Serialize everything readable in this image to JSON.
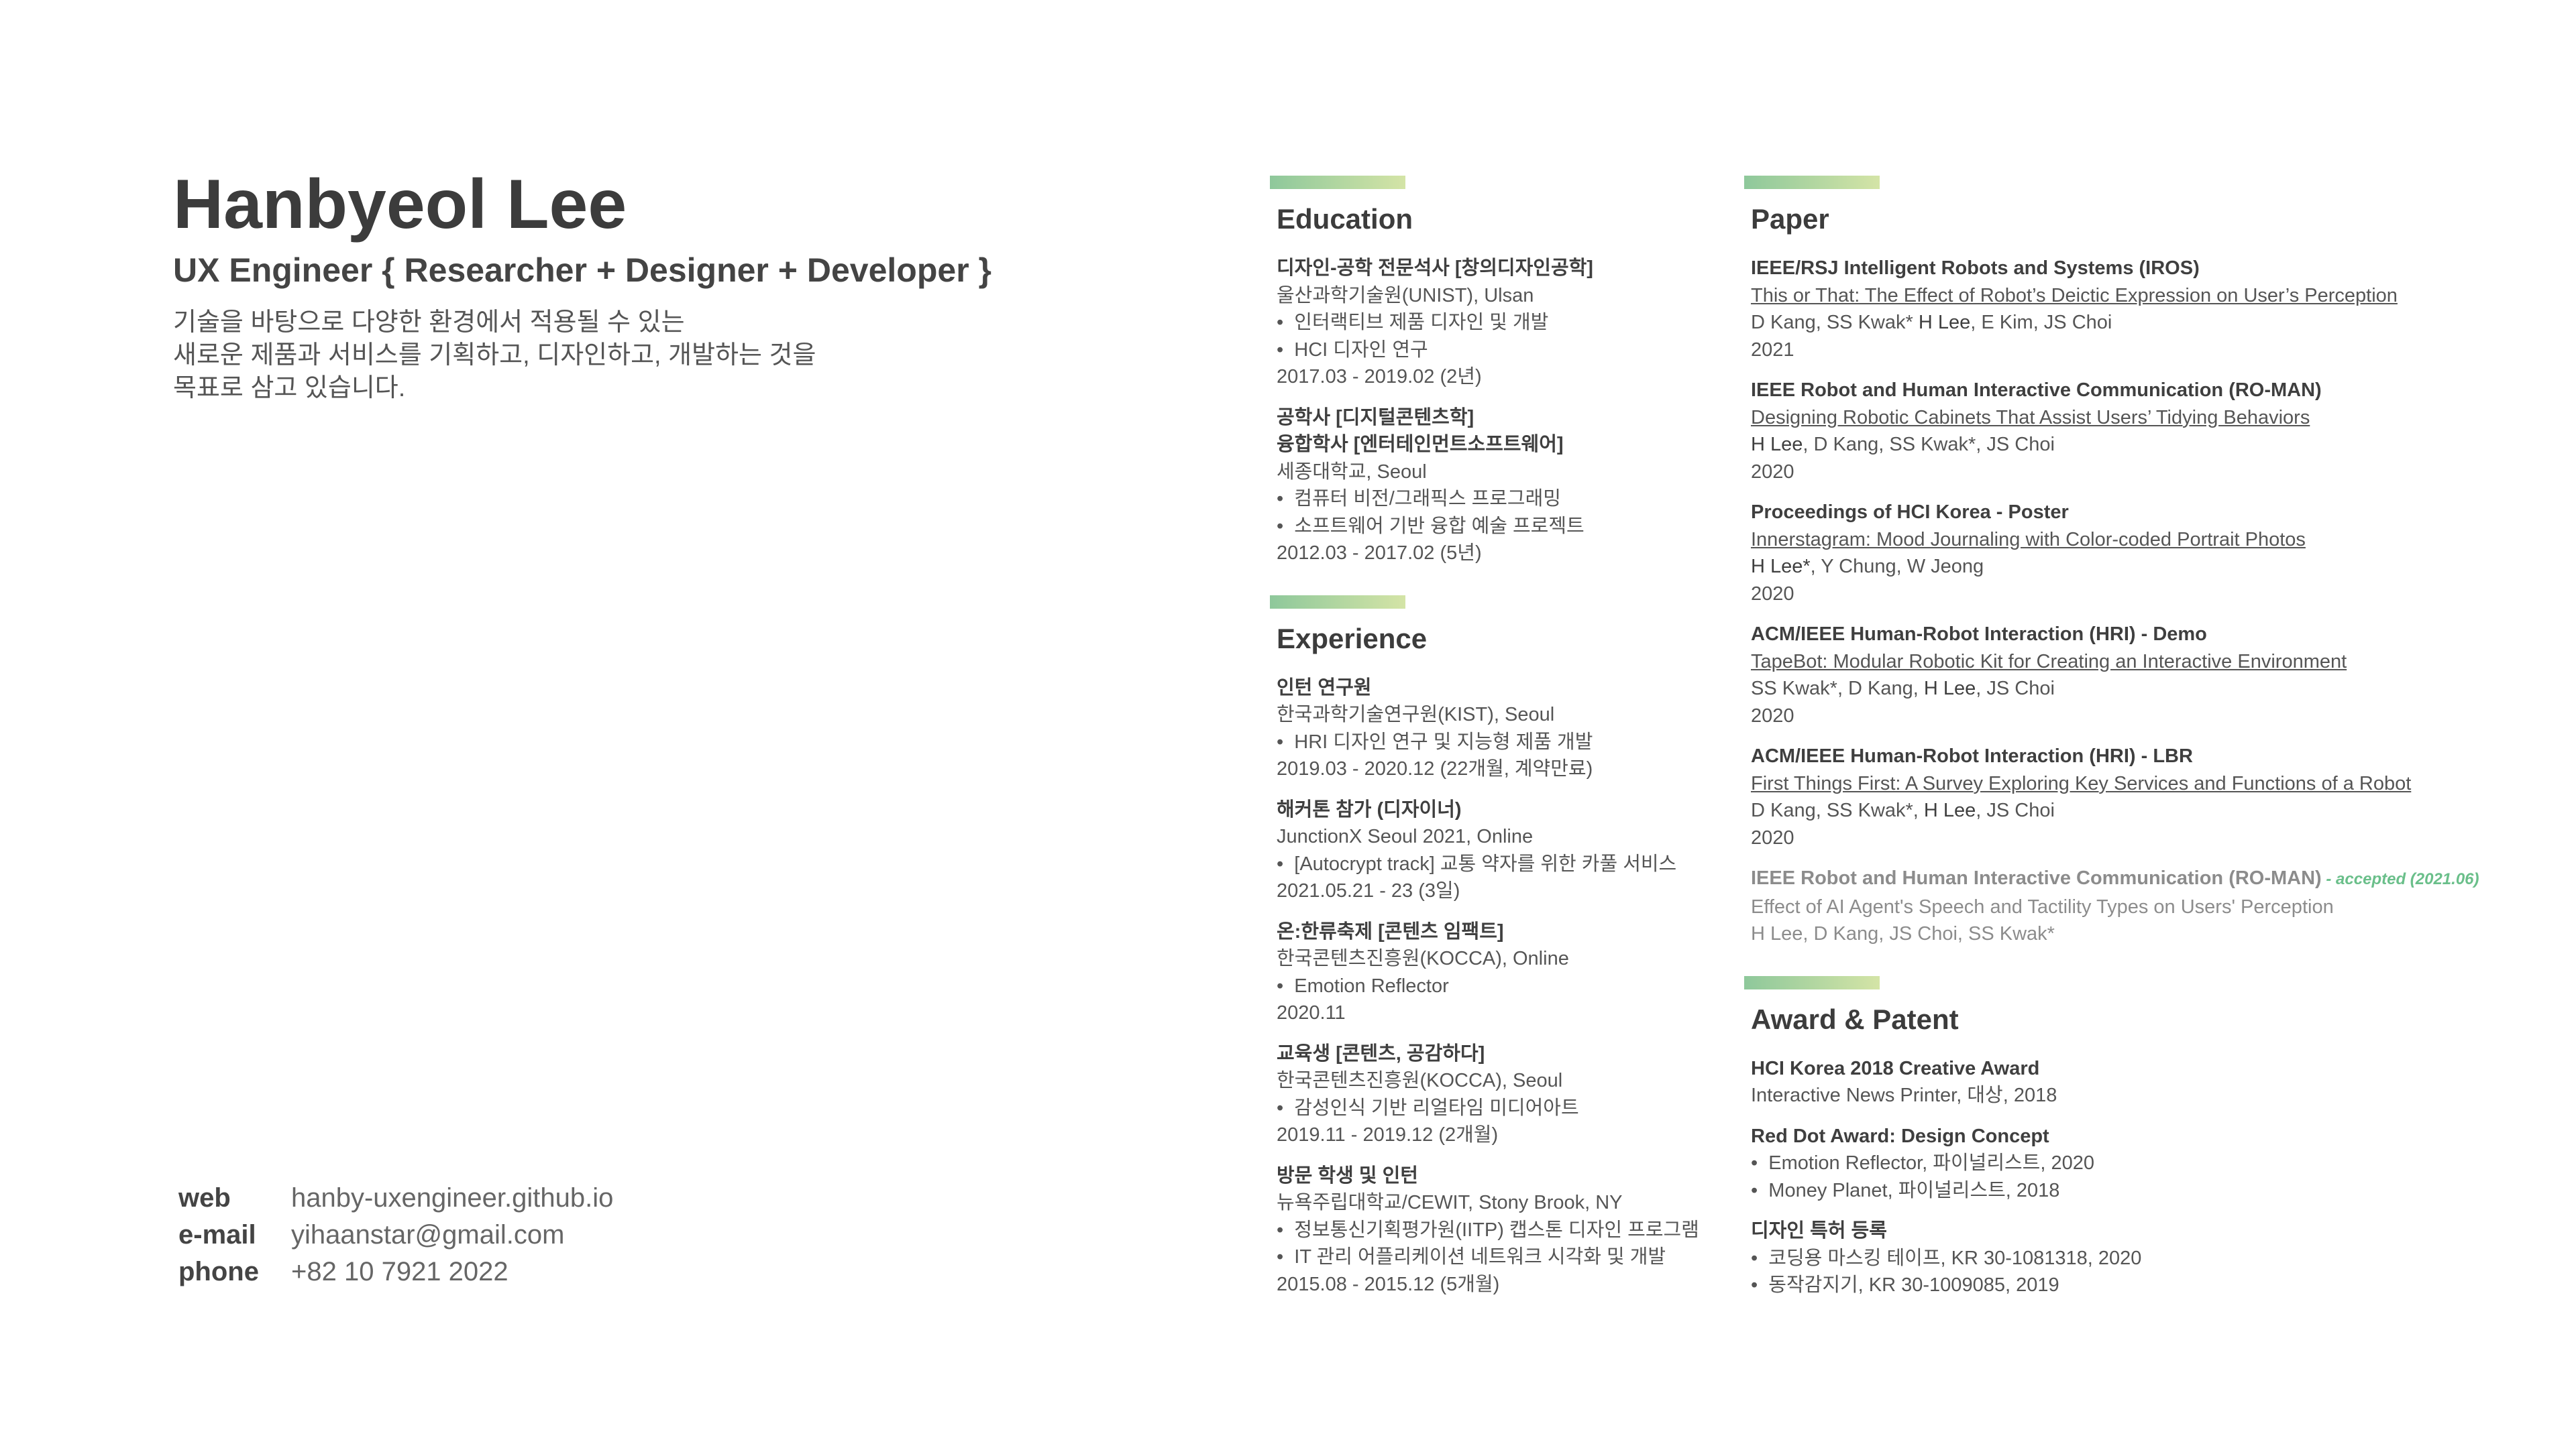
{
  "profile": {
    "name": "Hanbyeol Lee",
    "role": "UX Engineer { Researcher + Designer + Developer }",
    "intro": [
      "기술을 바탕으로 다양한 환경에서 적용될 수 있는",
      "새로운 제품과 서비스를 기획하고, 디자인하고, 개발하는 것을",
      "목표로 삼고 있습니다."
    ]
  },
  "contact": {
    "web_label": "web",
    "web": "hanby-uxengineer.github.io",
    "email_label": "e-mail",
    "email": "yihaanstar@gmail.com",
    "phone_label": "phone",
    "phone": "+82 10 7921 2022"
  },
  "education": {
    "title": "Education",
    "items": [
      {
        "lines": [
          "디자인-공학 전문석사 [창의디자인공학]"
        ],
        "org": "울산과학기술원(UNIST), Ulsan",
        "bullets": [
          "인터랙티브 제품 디자인 및 개발",
          "HCI 디자인 연구"
        ],
        "period": "2017.03 - 2019.02 (2년)"
      },
      {
        "lines": [
          "공학사 [디지털콘텐츠학]",
          "융합학사 [엔터테인먼트소프트웨어]"
        ],
        "org": "세종대학교, Seoul",
        "bullets": [
          "컴퓨터 비전/그래픽스 프로그래밍",
          "소프트웨어 기반 융합 예술 프로젝트"
        ],
        "period": "2012.03 - 2017.02 (5년)"
      }
    ]
  },
  "experience": {
    "title": "Experience",
    "items": [
      {
        "lines": [
          "인턴 연구원"
        ],
        "org": "한국과학기술연구원(KIST), Seoul",
        "bullets": [
          "HRI 디자인 연구 및 지능형 제품 개발"
        ],
        "period": "2019.03 - 2020.12 (22개월, 계약만료)"
      },
      {
        "lines": [
          "해커톤 참가 (디자이너)"
        ],
        "org": "JunctionX Seoul 2021, Online",
        "bullets": [
          "[Autocrypt track] 교통 약자를 위한 카풀 서비스"
        ],
        "period": "2021.05.21 - 23 (3일)"
      },
      {
        "lines": [
          "온:한류축제 [콘텐츠 임팩트]"
        ],
        "org": "한국콘텐츠진흥원(KOCCA), Online",
        "bullets": [
          "Emotion Reflector"
        ],
        "period": "2020.11"
      },
      {
        "lines": [
          "교육생 [콘텐츠, 공감하다]"
        ],
        "org": "한국콘텐츠진흥원(KOCCA), Seoul",
        "bullets": [
          "감성인식 기반 리얼타임 미디어아트"
        ],
        "period": "2019.11 - 2019.12 (2개월)"
      },
      {
        "lines": [
          "방문 학생 및 인턴"
        ],
        "org": "뉴욕주립대학교/CEWIT, Stony Brook, NY",
        "bullets": [
          "정보통신기획평가원(IITP) 캡스톤 디자인 프로그램",
          "IT 관리 어플리케이션 네트워크 시각화 및 개발"
        ],
        "period": "2015.08 - 2015.12 (5개월)"
      }
    ]
  },
  "paper": {
    "title": "Paper",
    "items": [
      {
        "venue": "IEEE/RSJ Intelligent Robots and Systems (IROS)",
        "title": "This or That: The Effect of Robot’s Deictic Expression on User’s Perception",
        "authors_pre": "D Kang, SS Kwak* ",
        "authors_self": "H Lee",
        "authors_post": ", E Kim, JS Choi",
        "year": "2021",
        "note": ""
      },
      {
        "venue": "IEEE Robot and Human Interactive Communication (RO-MAN)",
        "title": "Designing Robotic Cabinets That Assist Users’ Tidying Behaviors",
        "authors_pre": "",
        "authors_self": "H Lee",
        "authors_post": ", D Kang, SS Kwak*, JS Choi",
        "year": "2020",
        "note": ""
      },
      {
        "venue": "Proceedings of HCI Korea - Poster",
        "title": "Innerstagram: Mood Journaling with Color-coded Portrait Photos",
        "authors_pre": "",
        "authors_self": "H Lee*",
        "authors_post": ", Y Chung, W Jeong",
        "year": "2020",
        "note": ""
      },
      {
        "venue": "ACM/IEEE Human-Robot Interaction (HRI) - Demo",
        "title": "TapeBot: Modular Robotic Kit for Creating an Interactive Environment",
        "authors_pre": "SS Kwak*, D Kang, ",
        "authors_self": "H Lee",
        "authors_post": ", JS Choi",
        "year": "2020",
        "note": ""
      },
      {
        "venue": "ACM/IEEE Human-Robot Interaction (HRI) - LBR",
        "title": "First Things First: A Survey Exploring Key Services and Functions of a Robot",
        "authors_pre": "D Kang, SS Kwak*, ",
        "authors_self": "H Lee",
        "authors_post": ", JS Choi",
        "year": "2020",
        "note": ""
      }
    ],
    "pending": {
      "venue": "IEEE Robot and Human Interactive Communication (RO-MAN)",
      "note": " - accepted (2021.06)",
      "title": "Effect of AI Agent's Speech and Tactility Types on Users' Perception",
      "authors_pre": "",
      "authors_self": "H Lee",
      "authors_post": ", D Kang, JS Choi, SS Kwak*"
    }
  },
  "award": {
    "title": "Award & Patent",
    "items": [
      {
        "name": "HCI Korea 2018 Creative Award",
        "lines": [
          "Interactive News Printer, 대상, 2018"
        ],
        "bullets": []
      },
      {
        "name": "Red Dot Award: Design Concept",
        "lines": [],
        "bullets": [
          "Emotion Reflector, 파이널리스트, 2020",
          "Money Planet, 파이널리스트, 2018"
        ]
      },
      {
        "name": "디자인 특허 등록",
        "lines": [],
        "bullets": [
          "코딩용 마스킹 테이프, KR 30-1081318, 2020",
          "동작감지기, KR 30-1009085, 2019"
        ]
      }
    ]
  },
  "colors": {
    "accent_gradient_start": "#8ec89b",
    "accent_gradient_end": "#d4e4a6",
    "accepted_note": "#6abf8a",
    "text_dark": "#3c3c3c"
  }
}
